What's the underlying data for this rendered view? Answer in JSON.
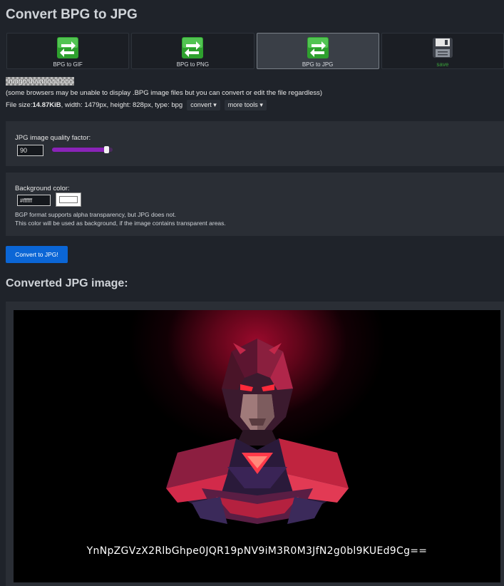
{
  "page": {
    "title": "Convert BPG to JPG"
  },
  "tools": [
    {
      "label": "BPG to GIF",
      "icon": "convert-arrows-icon",
      "active": false
    },
    {
      "label": "BPG to PNG",
      "icon": "convert-arrows-icon",
      "active": false
    },
    {
      "label": "BPG to JPG",
      "icon": "convert-arrows-icon",
      "active": true
    },
    {
      "label": "save",
      "icon": "floppy-disk-icon",
      "active": false
    }
  ],
  "source": {
    "image_alt": "image download.bpg",
    "note": "(some browsers may be unable to display .BPG image files but you can convert or edit the file regardless)",
    "file_size_label": "File size: ",
    "file_size": "14.87KiB",
    "dimensions": ", width: 1479px, height: 828px, type: bpg",
    "convert_menu": "convert",
    "more_tools_menu": "more tools"
  },
  "quality": {
    "label": "JPG image quality factor:",
    "value": "90",
    "slider_level": 0.9
  },
  "background": {
    "label": "Background color:",
    "value": "#ffffff",
    "swatch_color": "#ffffff",
    "desc_line1": "BGP format supports alpha transparency, but JPG does not.",
    "desc_line2": "This color will be used as background, if the image contains transparent areas."
  },
  "actions": {
    "convert_button": "Convert to JPG!"
  },
  "result": {
    "heading": "Converted JPG image:",
    "overlay_text": "YnNpZGVzX2RlbGhpe0JQR19pNV9iM3R0M3JfN2g0bl9KUEd9Cg=="
  },
  "colors": {
    "accent": "#0b66d6",
    "slider": "#8a23b8",
    "save_label": "#3aa03a"
  }
}
